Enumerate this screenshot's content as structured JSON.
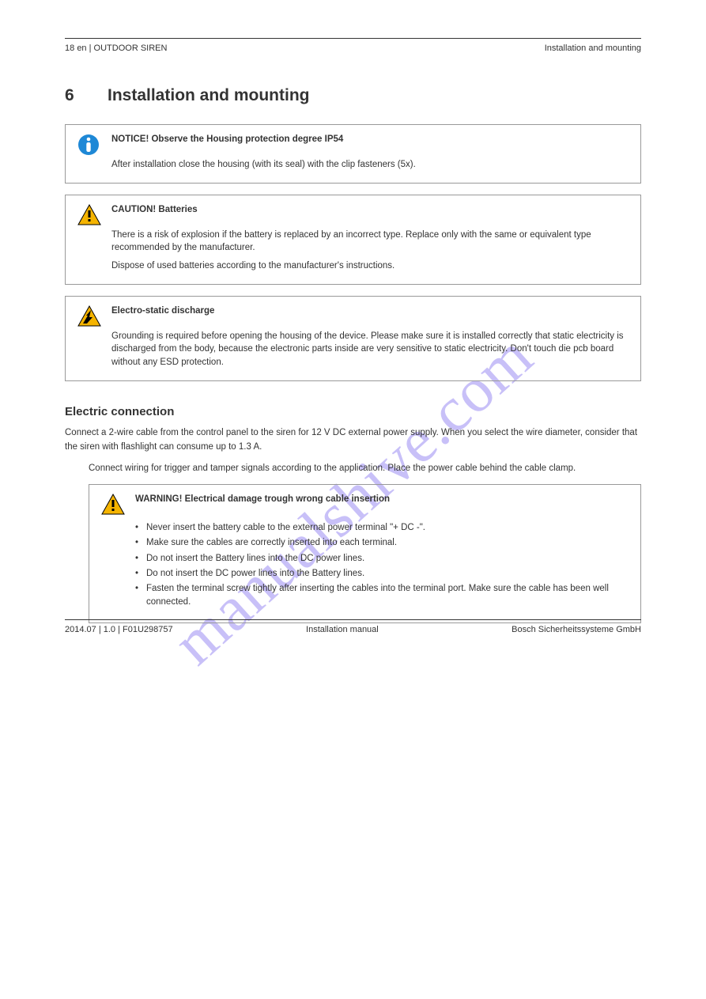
{
  "header": {
    "left": "OUTDOOR SIREN",
    "right": "Installation and mounting"
  },
  "section": {
    "number": "6",
    "title": "Installation and mounting"
  },
  "boxes": {
    "notice": {
      "title": "NOTICE! Observe the Housing protection degree IP54",
      "body": "After installation close the housing (with its seal) with the clip fasteners (5x)."
    },
    "caution": {
      "title": "CAUTION! Batteries",
      "line1": "There is a risk of explosion if the battery is replaced by an incorrect type. Replace only with the same or equivalent type recommended by the manufacturer.",
      "line2": "Dispose of used batteries according to the manufacturer's instructions."
    },
    "esd": {
      "title": "Electro-static discharge",
      "body": "Grounding is required before opening the housing of the device. Please make sure it is installed correctly that static electricity is discharged from the body, because the electronic parts inside are very sensitive to static electricity. Don't touch die pcb board without any ESD protection."
    },
    "warning": {
      "title": "WARNING! Electrical damage trough wrong cable insertion",
      "items": [
        "Never insert the battery cable to the external power terminal \"+ DC -\".",
        "Make sure the cables are correctly inserted into each terminal.",
        "Do not insert the Battery lines into the DC power lines.",
        "Do not insert the DC power lines into the Battery lines.",
        "Fasten the terminal screw tightly after inserting the cables into the terminal port. Make sure the cable has been well connected."
      ]
    }
  },
  "sub": {
    "heading": "Electric connection",
    "para1": "Connect a 2-wire cable from the control panel to the siren for 12 V DC external power supply. When you select the wire diameter, consider that the siren with flashlight can consume up to 1.3 A.",
    "para2": "Connect wiring for trigger and tamper signals according to the application. Place the power cable behind the cable clamp."
  },
  "footer": {
    "left": "2014.07 | 1.0 | F01U298757",
    "center": "Installation manual",
    "right": "Bosch Sicherheitssysteme GmbH"
  },
  "page_number": "18",
  "lang": "en",
  "watermark": "manualshive.com"
}
